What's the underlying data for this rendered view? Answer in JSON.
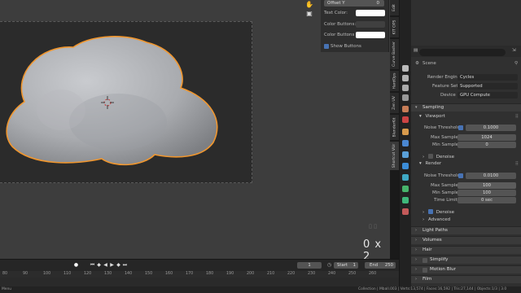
{
  "viewport": {
    "key_hint": "0 x 2"
  },
  "float_panel": {
    "offset_y_label": "Offset Y",
    "offset_y_value": "0",
    "rows": [
      {
        "label": "Text Color:",
        "color": "#ffffff"
      },
      {
        "label": "Color Buttons:",
        "color": "#404040"
      },
      {
        "label": "Color Buttons a...",
        "color": "#ffffff"
      }
    ],
    "show_buttons_label": "Show Buttons"
  },
  "vtabs": [
    "Edit",
    "KIT OPS",
    "Curve Basher",
    "HardOps",
    "Zen UV",
    "BlenderKit",
    "Shortcut VUr"
  ],
  "properties": {
    "scene_label": "Scene",
    "render_engine_label": "Render Engine",
    "render_engine_value": "Cycles",
    "feature_set_label": "Feature Set",
    "feature_set_value": "Supported",
    "device_label": "Device",
    "device_value": "GPU Compute",
    "sampling_label": "Sampling",
    "viewport_label": "Viewport",
    "vp_noise_label": "Noise Threshold",
    "vp_noise_value": "0.1000",
    "vp_max_label": "Max Samples",
    "vp_max_value": "1024",
    "vp_min_label": "Min Samples",
    "vp_min_value": "0",
    "denoise_label": "Denoise",
    "render_label": "Render",
    "r_noise_label": "Noise Threshold",
    "r_noise_value": "0.0100",
    "r_max_label": "Max Samples",
    "r_max_value": "100",
    "r_min_label": "Min Samples",
    "r_min_value": "100",
    "r_time_label": "Time Limit",
    "r_time_value": "0 sec",
    "r_denoise_label": "Denoise",
    "advanced_label": "Advanced",
    "light_paths_label": "Light Paths",
    "volumes_label": "Volumes",
    "hair_label": "Hair",
    "simplify_label": "Simplify",
    "motion_blur_label": "Motion Blur",
    "film_label": "Film"
  },
  "timeline": {
    "current_frame": "1",
    "start_label": "Start",
    "start_value": "1",
    "end_label": "End",
    "end_value": "250",
    "ticks": [
      "80",
      "90",
      "100",
      "110",
      "120",
      "130",
      "140",
      "150",
      "160",
      "170",
      "180",
      "190",
      "200",
      "210",
      "220",
      "230",
      "240",
      "250",
      "260"
    ]
  },
  "status": {
    "left": "Menu",
    "right": "Collection | Mball.003 | Verts:13,574 | Faces:16,592 | Tris:27,144 | Objects:1/3 | 3.0"
  },
  "colors": {
    "accent": "#4772b3",
    "selection_outline": "#e8902c",
    "object_fill": "#a7a9ad"
  }
}
